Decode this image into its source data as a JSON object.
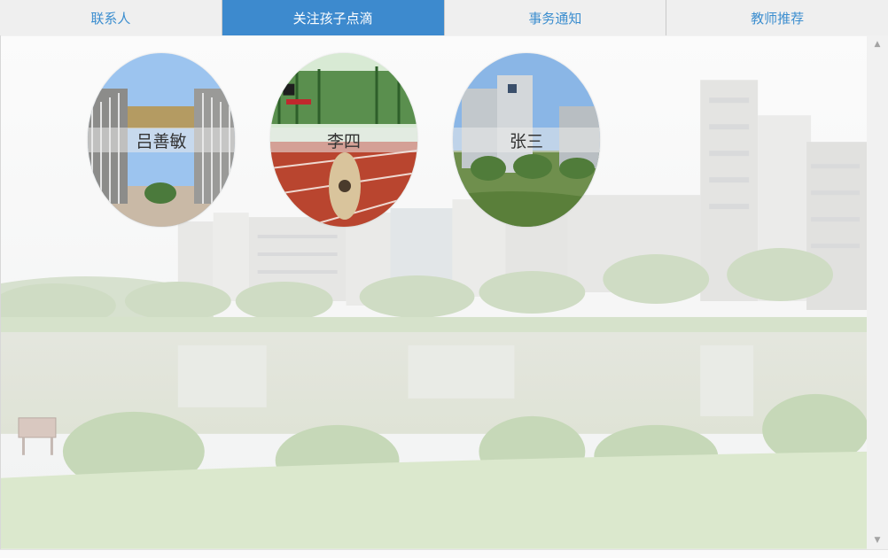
{
  "tabs": [
    {
      "label": "联系人",
      "active": false
    },
    {
      "label": "关注孩子点滴",
      "active": true
    },
    {
      "label": "事务通知",
      "active": false
    },
    {
      "label": "教师推荐",
      "active": false
    }
  ],
  "contacts": [
    {
      "name": "吕善敏"
    },
    {
      "name": "李四"
    },
    {
      "name": "张三"
    }
  ],
  "colors": {
    "tab_active_bg": "#3d8ace",
    "tab_text": "#3c8ecf",
    "tab_bg": "#efefef"
  }
}
